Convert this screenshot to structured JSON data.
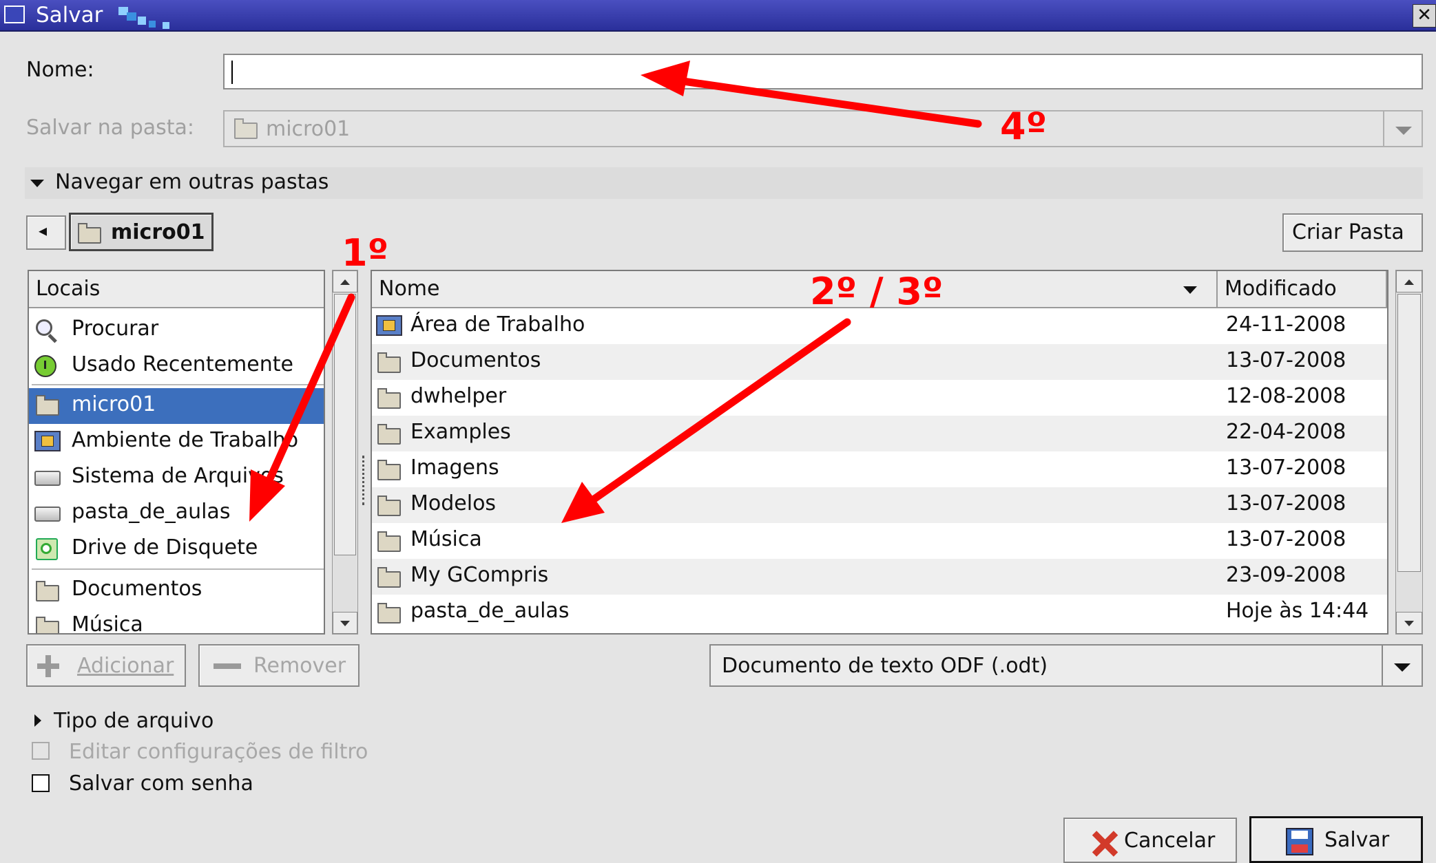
{
  "window": {
    "title": "Salvar",
    "close_glyph": "✕"
  },
  "form": {
    "name_label": "Nome:",
    "name_value": "",
    "folder_label": "Salvar na pasta:",
    "folder_value": "micro01",
    "browse_label": "Navegar em outras pastas"
  },
  "path_bar": {
    "back_glyph": "◂",
    "current": "micro01",
    "create_folder_label": "Criar Pasta"
  },
  "places": {
    "header": "Locais",
    "items": [
      {
        "label": "Procurar",
        "icon": "search-icon"
      },
      {
        "label": "Usado Recentemente",
        "icon": "recent-icon"
      },
      {
        "label": "micro01",
        "icon": "home-folder-icon",
        "selected": true
      },
      {
        "label": "Ambiente de Trabalho",
        "icon": "desktop-icon"
      },
      {
        "label": "Sistema de Arquivos",
        "icon": "drive-icon"
      },
      {
        "label": "pasta_de_aulas",
        "icon": "drive-icon"
      },
      {
        "label": "Drive de Disquete",
        "icon": "floppy-icon"
      },
      {
        "label": "Documentos",
        "icon": "folder-icon"
      },
      {
        "label": "Música",
        "icon": "folder-icon"
      }
    ],
    "add_label": "Adicionar",
    "remove_label": "Remover"
  },
  "files": {
    "headers": {
      "name": "Nome",
      "modified": "Modificado"
    },
    "rows": [
      {
        "name": "Área de Trabalho",
        "modified": "24-11-2008",
        "icon": "desktop-icon"
      },
      {
        "name": "Documentos",
        "modified": "13-07-2008",
        "icon": "folder-icon"
      },
      {
        "name": "dwhelper",
        "modified": "12-08-2008",
        "icon": "folder-icon"
      },
      {
        "name": "Examples",
        "modified": "22-04-2008",
        "icon": "folder-icon"
      },
      {
        "name": "Imagens",
        "modified": "13-07-2008",
        "icon": "folder-icon"
      },
      {
        "name": "Modelos",
        "modified": "13-07-2008",
        "icon": "folder-icon"
      },
      {
        "name": "Música",
        "modified": "13-07-2008",
        "icon": "folder-icon"
      },
      {
        "name": "My GCompris",
        "modified": "23-09-2008",
        "icon": "folder-icon"
      },
      {
        "name": "pasta_de_aulas",
        "modified": "Hoje às 14:44",
        "icon": "folder-icon"
      }
    ]
  },
  "filter": {
    "selected": "Documento de texto ODF (.odt)"
  },
  "options": {
    "file_type_label": "Tipo de arquivo",
    "edit_filter_label": "Editar configurações de filtro",
    "password_label": "Salvar com senha"
  },
  "actions": {
    "cancel_label": "Cancelar",
    "save_label": "Salvar"
  },
  "annotations": {
    "step1": "1º",
    "step23": "2º / 3º",
    "step4": "4º"
  },
  "colors": {
    "annotation": "#ff0000",
    "selection": "#3c6fbd",
    "titlebar": "#2a2f9a"
  }
}
